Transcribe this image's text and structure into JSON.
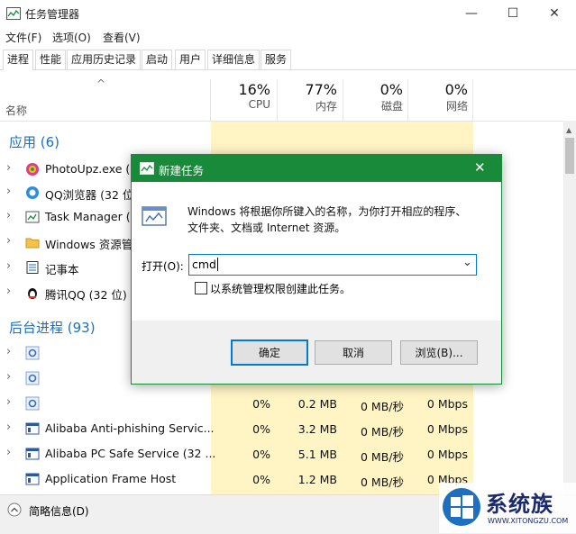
{
  "window": {
    "title": "任务管理器",
    "minimize_glyph": "—",
    "maximize_glyph": "☐",
    "close_glyph": "✕"
  },
  "menu": [
    "文件(F)",
    "选项(O)",
    "查看(V)"
  ],
  "tabs": [
    "进程",
    "性能",
    "应用历史记录",
    "启动",
    "用户",
    "详细信息",
    "服务"
  ],
  "columns": {
    "sort_glyph": "^",
    "name_label": "名称",
    "cpu": {
      "pct": "16%",
      "label": "CPU"
    },
    "mem": {
      "pct": "77%",
      "label": "内存"
    },
    "disk": {
      "pct": "0%",
      "label": "磁盘"
    },
    "net": {
      "pct": "0%",
      "label": "网络"
    }
  },
  "apps_section": "应用 (6)",
  "apps": [
    {
      "name": "PhotoUpz.exe (3",
      "icon": "photoupz-icon"
    },
    {
      "name": "QQ浏览器 (32 位",
      "icon": "qq-browser-icon"
    },
    {
      "name": "Task Manager (2",
      "icon": "task-manager-icon"
    },
    {
      "name": "Windows 资源管",
      "icon": "explorer-folder-icon"
    },
    {
      "name": "记事本",
      "icon": "notepad-icon"
    },
    {
      "name": "腾讯QQ (32 位)",
      "icon": "qq-penguin-icon"
    }
  ],
  "bg_section": "后台进程 (93)",
  "bg": [
    {
      "name": "",
      "icon": "gear-icon",
      "cpu": "",
      "mem": "",
      "disk": "",
      "net": ""
    },
    {
      "name": "",
      "icon": "gear-icon",
      "cpu": "",
      "mem": "",
      "disk": "",
      "net": ""
    },
    {
      "name": "",
      "icon": "gear-icon",
      "cpu": "0%",
      "mem": "0.2 MB",
      "disk": "0 MB/秒",
      "net": "0 Mbps"
    },
    {
      "name": "Alibaba Anti-phishing Servic...",
      "icon": "app-window-icon",
      "cpu": "0%",
      "mem": "3.2 MB",
      "disk": "0 MB/秒",
      "net": "0 Mbps"
    },
    {
      "name": "Alibaba PC Safe Service (32 ...",
      "icon": "app-window-icon",
      "cpu": "0%",
      "mem": "5.1 MB",
      "disk": "0 MB/秒",
      "net": "0 Mbps"
    },
    {
      "name": "Application Frame Host",
      "icon": "app-window-icon",
      "cpu": "0%",
      "mem": "1.2 MB",
      "disk": "0 MB/秒",
      "net": "0 Mbps"
    }
  ],
  "status": {
    "label": "简略信息(D)"
  },
  "dialog": {
    "title": "新建任务",
    "description_line1": "Windows 将根据你所键入的名称，为你打开相应的程序、",
    "description_line2": "文件夹、文档或 Internet 资源。",
    "open_label": "打开(O):",
    "input_value": "cmd",
    "admin_checkbox_label": "以系统管理权限创建此任务。",
    "ok_button": "确定",
    "cancel_button": "取消",
    "browse_button": "浏览(B)..."
  },
  "watermark": {
    "brand": "系统族",
    "url": "WWW.XITONGZU.COM"
  }
}
